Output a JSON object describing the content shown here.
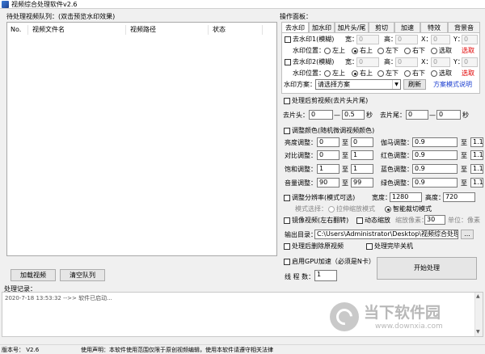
{
  "window": {
    "title": "视频综合处理软件v2.6"
  },
  "queue": {
    "label": "待处理视频队列：(双击预览水印效果)",
    "columns": [
      "No.",
      "视频文件名",
      "视频路径",
      "状态"
    ],
    "buttons": {
      "load": "加载视频",
      "clear": "清空队列"
    }
  },
  "log": {
    "label": "处理记录：",
    "entries": [
      "2020-7-18 13:53:32 -->> 软件已启动..."
    ]
  },
  "panel": {
    "label": "操作面板：",
    "tabs": [
      "去水印",
      "加水印",
      "加片头/尾",
      "剪切",
      "加速",
      "特效",
      "背景音"
    ],
    "wm1": {
      "check": "去水印1(模糊)",
      "w_label": "宽：",
      "w": "0",
      "h_label": "高：",
      "h": "0",
      "x_label": "X：",
      "x": "0",
      "y_label": "Y：",
      "y": "0",
      "pos_label": "水印位置：",
      "pos_opts": [
        "左上",
        "右上",
        "左下",
        "右下",
        "选取"
      ],
      "pick": "选取"
    },
    "wm2": {
      "check": "去水印2(模糊)",
      "w_label": "宽：",
      "w": "0",
      "h_label": "高：",
      "h": "0",
      "x_label": "X：",
      "x": "0",
      "y_label": "Y：",
      "y": "0",
      "pos_label": "水印位置：",
      "pos_opts": [
        "左上",
        "右上",
        "左下",
        "右下",
        "选取"
      ],
      "pick": "选取"
    },
    "scheme": {
      "label": "水印方案：",
      "value": "请选择方案",
      "refresh": "刷新",
      "help": "方案模式说明"
    }
  },
  "trim": {
    "check": "处理后剪视频(去片头片尾)",
    "head_label": "去片头：",
    "head_a": "0",
    "dash": "—",
    "head_b": "0.5",
    "sec": "秒",
    "tail_label": "去片尾：",
    "tail_a": "0",
    "tail_b": "0"
  },
  "color": {
    "check": "调整颜色(随机微调视频颜色)",
    "rows": [
      {
        "label": "亮度调整：",
        "a": "0",
        "to": "至",
        "b": "0",
        "label2": "伽马调整：",
        "c": "0.9",
        "d": "1.1"
      },
      {
        "label": "对比调整：",
        "a": "0",
        "to": "至",
        "b": "1",
        "label2": "红色调整：",
        "c": "0.9",
        "d": "1.1"
      },
      {
        "label": "饱和调整：",
        "a": "1",
        "to": "至",
        "b": "1",
        "label2": "蓝色调整：",
        "c": "0.9",
        "d": "1.1"
      },
      {
        "label": "音量调整：",
        "a": "90",
        "to": "至",
        "b": "99",
        "label2": "绿色调整：",
        "c": "0.9",
        "d": "1.1"
      }
    ]
  },
  "resolution": {
    "check": "调整分辨率(模式可选)",
    "w_label": "宽度：",
    "w": "1280",
    "h_label": "高度：",
    "h": "720",
    "mode_label": "模式选择：",
    "mode_stretch": "拉伸缩放模式",
    "mode_crop": "智能裁切模式"
  },
  "mirror": {
    "check": "镜像视频(左右翻转)",
    "dyn_check": "动态缩放",
    "zoom_label": "缩放像素：",
    "zoom": "30",
    "unit": "单位：像素"
  },
  "output": {
    "label": "输出目录：",
    "path": "C:\\Users\\Administrator\\Desktop\\视频综合处理",
    "browse": "..."
  },
  "options": {
    "delete_src": "处理后删除原视频",
    "shutdown": "处理完毕关机",
    "gpu": "启用GPU加速（必须是N卡）"
  },
  "threads": {
    "label": "线 程 数：",
    "value": "1"
  },
  "start_button": "开始处理",
  "status": {
    "version": "版本号： V2.6",
    "notice": "使用声明：本软件使用范围仅限于原创视频编辑，使用本软件请遵守相关法律"
  },
  "watermark": {
    "brand": "当下软件园",
    "url": "www.downxia.com"
  }
}
